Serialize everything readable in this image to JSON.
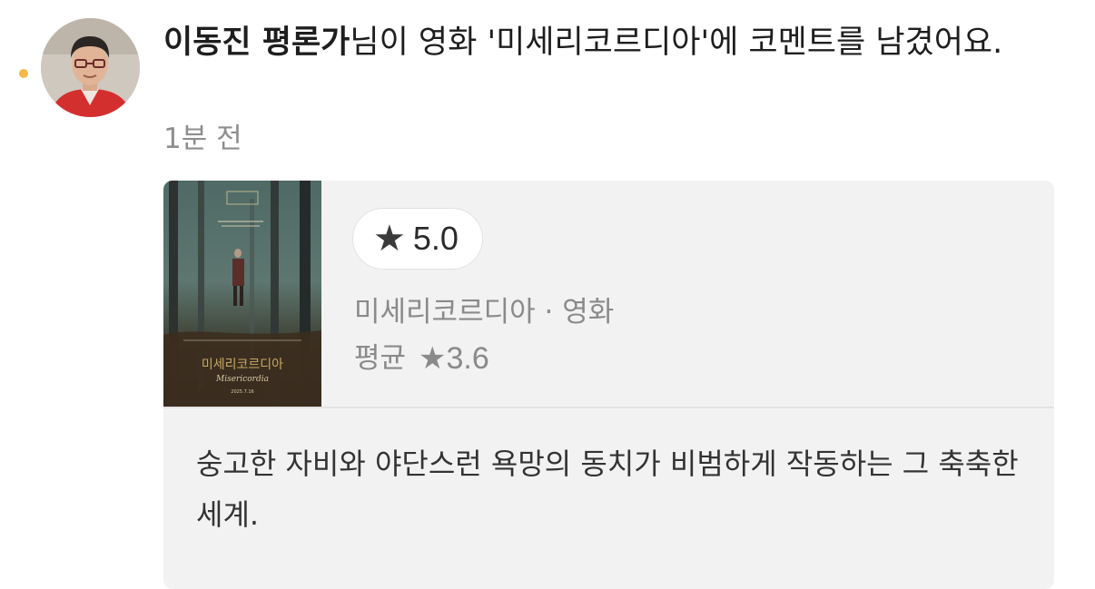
{
  "notification": {
    "author": "이동진 평론가",
    "message": "님이 영화 '미세리코르디아'에 코멘트를 남겼어요.",
    "time": "1분 전",
    "unread": true,
    "unread_color": "#f5b94a"
  },
  "card": {
    "rating_icon": "star-icon",
    "rating": "5.0",
    "movie_line": "미세리코르디아 · 영화",
    "avg_label": "평균",
    "avg_rating": "★3.6",
    "comment": "숭고한 자비와 야단스런 욕망의 동치가 비범하게 작동하는 그 축축한 세계.",
    "poster": {
      "title_kr": "미세리코르디아",
      "title_en": "Misericordia",
      "date": "2025.7.16"
    }
  }
}
